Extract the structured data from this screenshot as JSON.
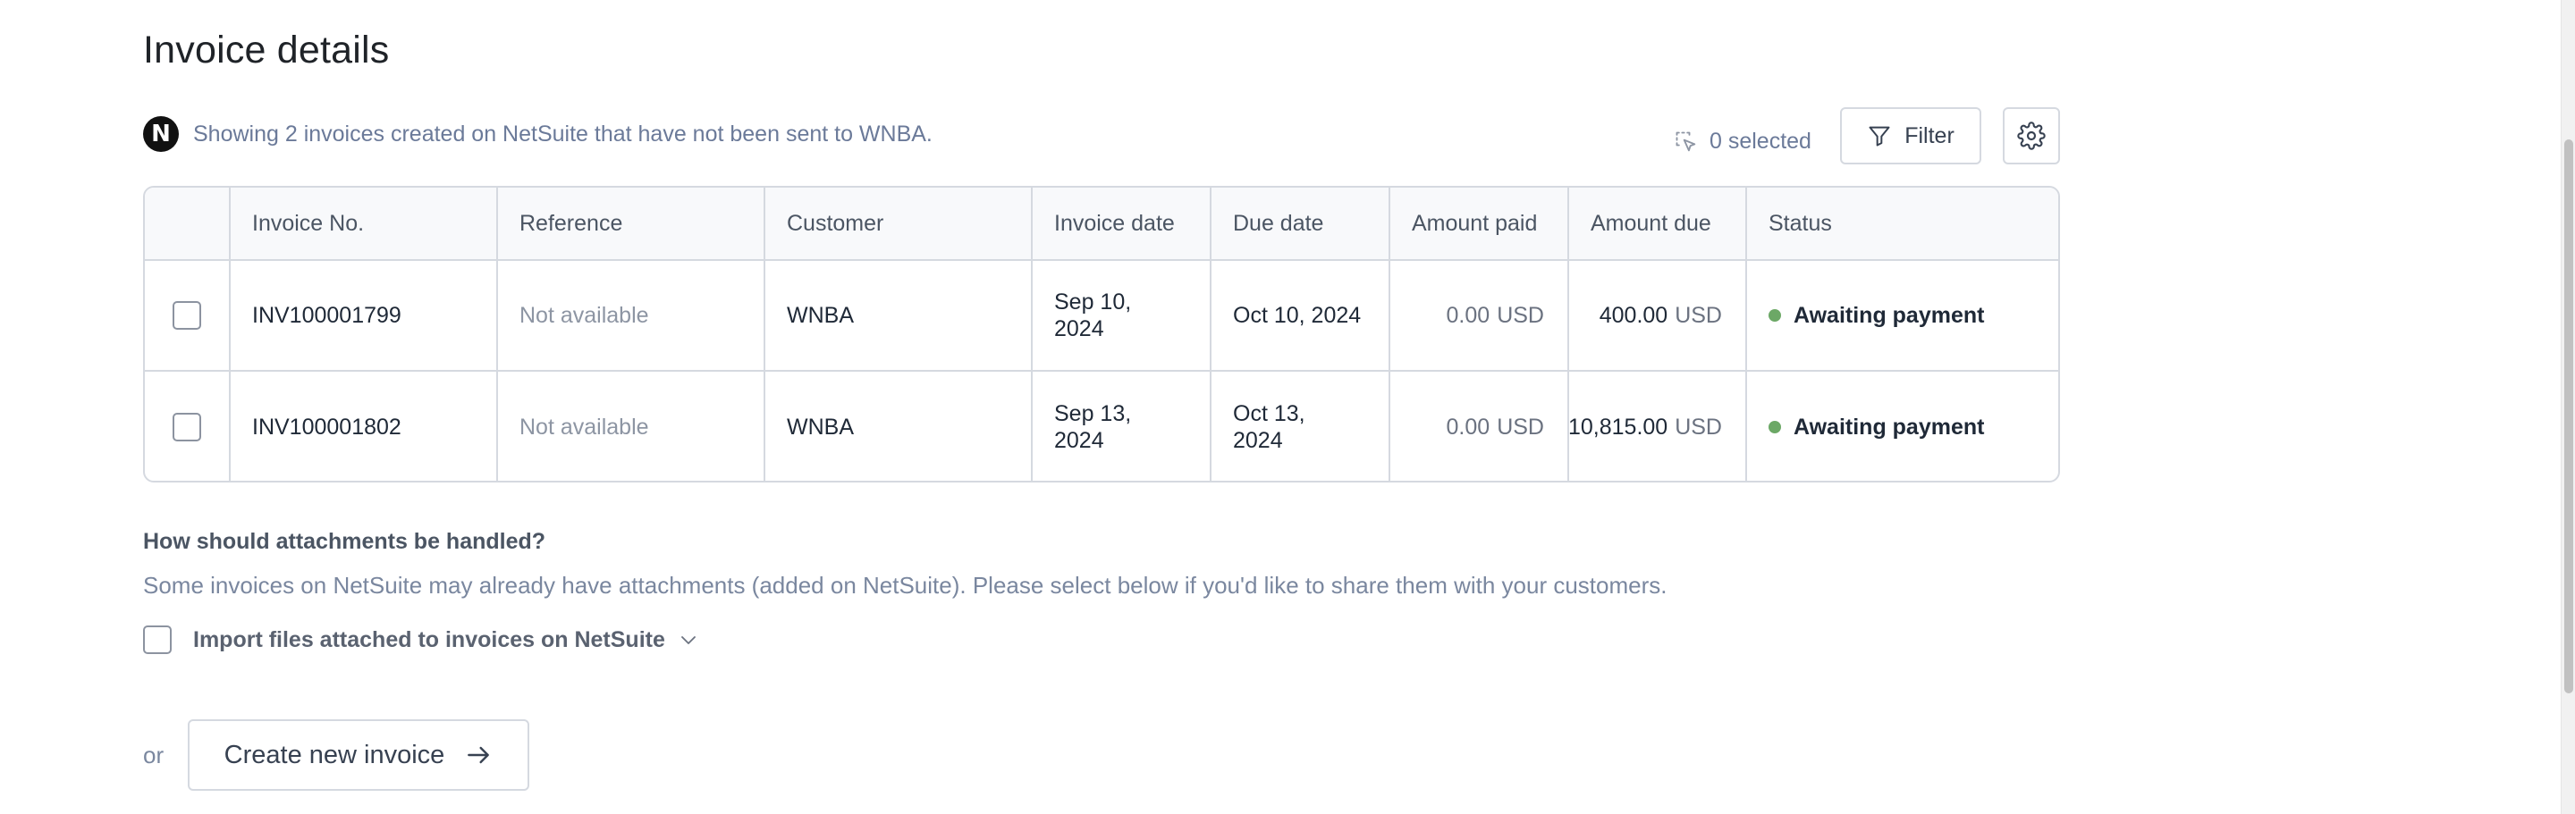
{
  "page": {
    "title": "Invoice details"
  },
  "info": {
    "logo_letter": "N",
    "text": "Showing 2 invoices created on NetSuite that have not been sent to WNBA."
  },
  "toolbar": {
    "selected_label": "0 selected",
    "filter_label": "Filter"
  },
  "table": {
    "headers": [
      "Invoice No.",
      "Reference",
      "Customer",
      "Invoice date",
      "Due date",
      "Amount paid",
      "Amount due",
      "Status"
    ],
    "rows": [
      {
        "invoice_no": "INV100001799",
        "reference": "Not available",
        "customer": "WNBA",
        "invoice_date_line1": "Sep 10,",
        "invoice_date_line2": "2024",
        "due_date_line1": "Oct 10, 2024",
        "due_date_line2": "",
        "amount_paid": "0.00",
        "amount_paid_unit": "USD",
        "amount_due": "400.00",
        "amount_due_unit": "USD",
        "status": "Awaiting payment"
      },
      {
        "invoice_no": "INV100001802",
        "reference": "Not available",
        "customer": "WNBA",
        "invoice_date_line1": "Sep 13,",
        "invoice_date_line2": "2024",
        "due_date_line1": "Oct 13,",
        "due_date_line2": "2024",
        "amount_paid": "0.00",
        "amount_paid_unit": "USD",
        "amount_due": "10,815.00",
        "amount_due_unit": "USD",
        "status": "Awaiting payment"
      }
    ]
  },
  "attachments": {
    "heading": "How should attachments be handled?",
    "description": "Some invoices on NetSuite may already have attachments (added on NetSuite). Please select below if you'd like to share them with your customers.",
    "import_label": "Import files attached to invoices on NetSuite"
  },
  "footer": {
    "or_label": "or",
    "create_label": "Create new invoice"
  },
  "colors": {
    "status_dot": "#6ca866",
    "border": "#d5d9e0",
    "muted_text": "#7a879f"
  },
  "icons": {
    "logo": "netsuite-logo",
    "selected": "selection-cursor-icon",
    "filter": "filter-icon",
    "settings": "gear-icon",
    "expand": "chevron-down-icon",
    "create": "arrow-right-icon"
  }
}
